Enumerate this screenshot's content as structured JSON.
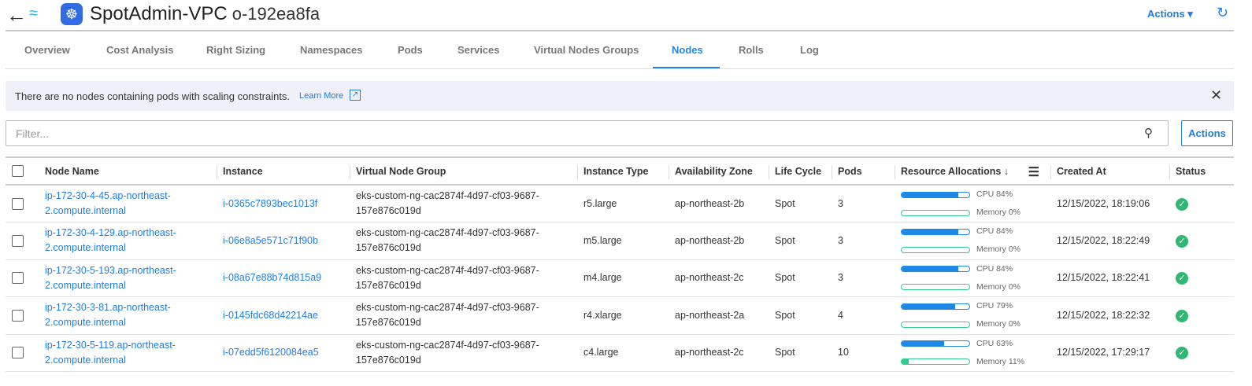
{
  "header": {
    "title": "SpotAdmin-VPC",
    "id": "o-192ea8fa",
    "actions": "Actions ▾"
  },
  "tabs": [
    "Overview",
    "Cost Analysis",
    "Right Sizing",
    "Namespaces",
    "Pods",
    "Services",
    "Virtual Nodes Groups",
    "Nodes",
    "Rolls",
    "Log"
  ],
  "active_tab": "Nodes",
  "banner": {
    "message": "There are no nodes containing pods with scaling constraints.",
    "link": "Learn More"
  },
  "filter": {
    "placeholder": "Filter...",
    "value": ""
  },
  "actions_button": "Actions",
  "columns": [
    "Node Name",
    "Instance",
    "Virtual Node Group",
    "Instance Type",
    "Availability Zone",
    "Life Cycle",
    "Pods",
    "Resource Allocations ↓",
    "Created At",
    "Status"
  ],
  "colors": {
    "cpu": "#1e88e5",
    "memory": "#2ecc8f",
    "status_ok": "#2eb872"
  },
  "rows": [
    {
      "name1": "ip-172-30-4-45.ap-northeast-",
      "name2": "2.compute.internal",
      "instance": "i-0365c7893bec1013f",
      "vng1": "eks-custom-ng-cac2874f-4d97-cf03-9687-",
      "vng2": "157e876c019d",
      "type": "r5.large",
      "az": "ap-northeast-2b",
      "life": "Spot",
      "pods": "3",
      "cpu": 84,
      "mem": 0,
      "cpu_label": "CPU 84%",
      "mem_label": "Memory 0%",
      "created": "12/15/2022, 18:19:06"
    },
    {
      "name1": "ip-172-30-4-129.ap-northeast-",
      "name2": "2.compute.internal",
      "instance": "i-06e8a5e571c71f90b",
      "vng1": "eks-custom-ng-cac2874f-4d97-cf03-9687-",
      "vng2": "157e876c019d",
      "type": "m5.large",
      "az": "ap-northeast-2b",
      "life": "Spot",
      "pods": "3",
      "cpu": 84,
      "mem": 0,
      "cpu_label": "CPU 84%",
      "mem_label": "Memory 0%",
      "created": "12/15/2022, 18:22:49"
    },
    {
      "name1": "ip-172-30-5-193.ap-northeast-",
      "name2": "2.compute.internal",
      "instance": "i-08a67e88b74d815a9",
      "vng1": "eks-custom-ng-cac2874f-4d97-cf03-9687-",
      "vng2": "157e876c019d",
      "type": "m4.large",
      "az": "ap-northeast-2c",
      "life": "Spot",
      "pods": "3",
      "cpu": 84,
      "mem": 0,
      "cpu_label": "CPU 84%",
      "mem_label": "Memory 0%",
      "created": "12/15/2022, 18:22:41"
    },
    {
      "name1": "ip-172-30-3-81.ap-northeast-",
      "name2": "2.compute.internal",
      "instance": "i-0145fdc68d42214ae",
      "vng1": "eks-custom-ng-cac2874f-4d97-cf03-9687-",
      "vng2": "157e876c019d",
      "type": "r4.xlarge",
      "az": "ap-northeast-2a",
      "life": "Spot",
      "pods": "4",
      "cpu": 79,
      "mem": 0,
      "cpu_label": "CPU 79%",
      "mem_label": "Memory 0%",
      "created": "12/15/2022, 18:22:32"
    },
    {
      "name1": "ip-172-30-5-119.ap-northeast-",
      "name2": "2.compute.internal",
      "instance": "i-07edd5f6120084ea5",
      "vng1": "eks-custom-ng-cac2874f-4d97-cf03-9687-",
      "vng2": "157e876c019d",
      "type": "c4.large",
      "az": "ap-northeast-2c",
      "life": "Spot",
      "pods": "10",
      "cpu": 63,
      "mem": 11,
      "cpu_label": "CPU 63%",
      "mem_label": "Memory 11%",
      "created": "12/15/2022, 17:29:17"
    }
  ]
}
